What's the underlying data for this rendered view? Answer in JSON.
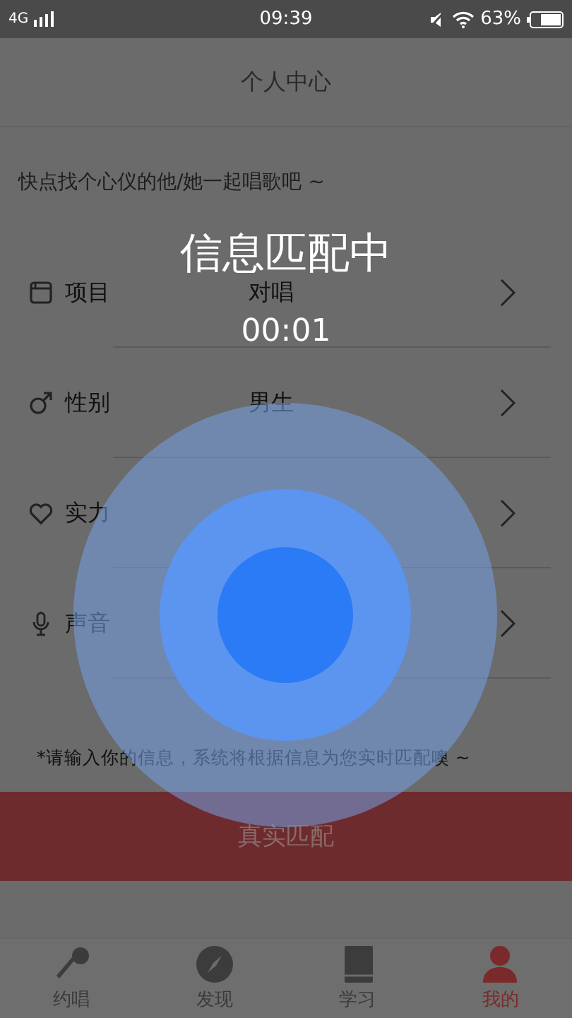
{
  "status_bar": {
    "network": "4G",
    "time": "09:39",
    "battery": "63%"
  },
  "header": {
    "title": "个人中心"
  },
  "subtitle": "快点找个心仪的他/她一起唱歌吧 ~",
  "rows": [
    {
      "label": "项目",
      "value": "对唱"
    },
    {
      "label": "性别",
      "value": "男生"
    },
    {
      "label": "实力"
    },
    {
      "label": "声音"
    }
  ],
  "note": "*请输入你的信息，系统将根据信息为您实时匹配噢 ~",
  "match_button": "真实匹配",
  "matching": {
    "title": "信息匹配中",
    "timer": "00:01"
  },
  "tabs": [
    {
      "label": "约唱",
      "selected": false
    },
    {
      "label": "发现",
      "selected": false
    },
    {
      "label": "学习",
      "selected": false
    },
    {
      "label": "我的",
      "selected": true
    }
  ]
}
